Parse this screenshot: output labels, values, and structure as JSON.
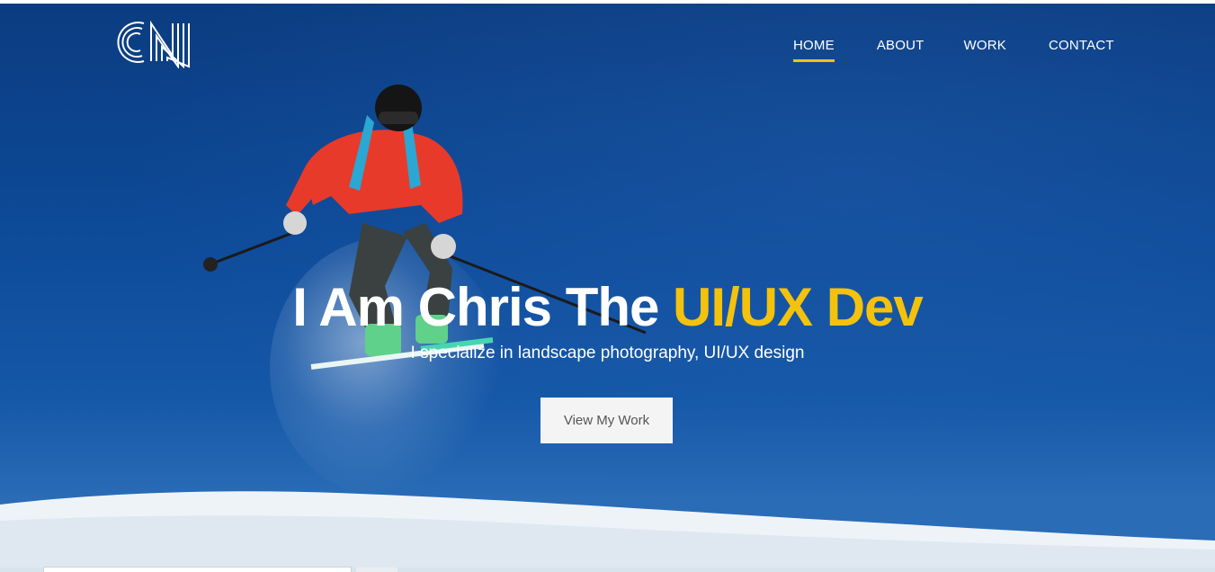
{
  "header": {
    "logo_text": "CN",
    "nav": [
      {
        "label": "HOME",
        "active": true
      },
      {
        "label": "ABOUT",
        "active": false
      },
      {
        "label": "WORK",
        "active": false
      },
      {
        "label": "CONTACT",
        "active": false
      }
    ]
  },
  "hero": {
    "headline_prefix": "I Am Chris The ",
    "headline_accent": "UI/UX Dev",
    "subheadline": "I specialize in landscape photography, UI/UX design",
    "cta_label": "View My Work",
    "background": "skier-jumping-photo"
  },
  "colors": {
    "accent": "#f4c20d",
    "sky": "#0d4a98",
    "cta_bg": "#f4f4f4"
  }
}
